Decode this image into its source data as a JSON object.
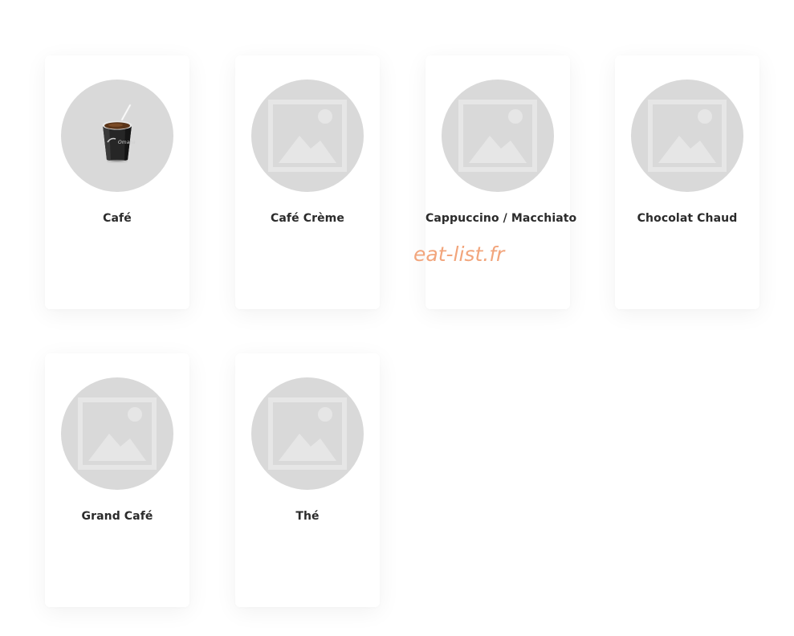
{
  "products": [
    {
      "name": "Café",
      "image": "coffee-cup-image"
    },
    {
      "name": "Café Crème",
      "image": "placeholder-image-icon"
    },
    {
      "name": "Cappuccino / Macchiato",
      "image": "placeholder-image-icon"
    },
    {
      "name": "Chocolat Chaud",
      "image": "placeholder-image-icon"
    },
    {
      "name": "Grand Café",
      "image": "placeholder-image-icon"
    },
    {
      "name": "Thé",
      "image": "placeholder-image-icon"
    }
  ],
  "cup_brand": "Omaha",
  "watermark": "eat-list.fr",
  "colors": {
    "placeholder_bg": "#d9d9d9",
    "placeholder_icon": "#e6e6e6",
    "label_text": "#2b2b2b",
    "watermark": "#f2a57c"
  }
}
